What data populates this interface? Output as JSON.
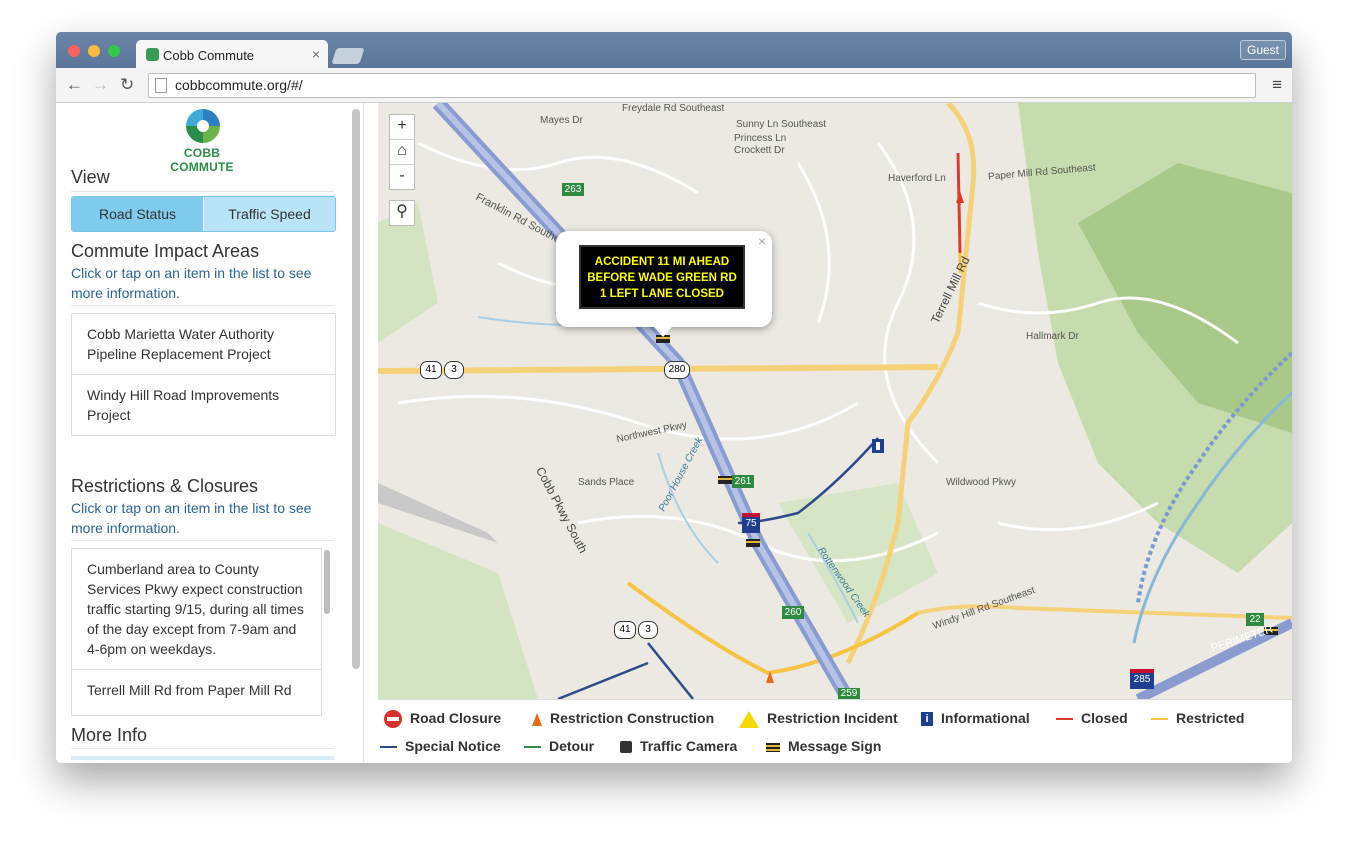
{
  "browser": {
    "tab_title": "Cobb Commute",
    "guest_label": "Guest",
    "url": "cobbcommute.org/#/"
  },
  "sidebar": {
    "logo_text": "COBB COMMUTE",
    "view_heading": "View",
    "view_buttons": [
      "Road Status",
      "Traffic Speed"
    ],
    "impact_heading": "Commute Impact Areas",
    "impact_hint": "Click or tap on an item in the list to see more information.",
    "impact_items": [
      "Cobb Marietta Water Authority Pipeline Replacement Project",
      "Windy Hill Road Improvements Project"
    ],
    "restrictions_heading": "Restrictions & Closures",
    "restrictions_hint": "Click or tap on an item in the list to see more information.",
    "restriction_items": [
      "Cumberland area to County Services Pkwy expect construction traffic starting 9/15, during all times of the day except from 7-9am and 4-6pm on weekdays.",
      "Terrell Mill Rd from Paper Mill Rd"
    ],
    "more_info_heading": "More Info"
  },
  "map": {
    "zoom_controls": [
      "+",
      "⌂",
      "-"
    ],
    "search_icon": "magnifier",
    "popup": {
      "sign_lines": [
        "ACCIDENT 11 MI AHEAD",
        "BEFORE WADE GREEN RD",
        "1 LEFT LANE CLOSED"
      ],
      "close_glyph": "×"
    },
    "labels": {
      "franklin": "Franklin Rd Southeast",
      "terrell": "Terrell Mill Rd",
      "cobb_pkwy": "Cobb Pkwy South",
      "sands": "Sands Place",
      "hallmark": "Hallmark Dr",
      "paper_mill": "Paper Mill Rd Southeast",
      "wildwood": "Wildwood Pkwy",
      "perimeter": "PERIMETER",
      "haverford": "Haverford Ln",
      "mayes": "Mayes Dr",
      "freydale": "Freydale Rd Southeast",
      "sunny": "Sunny Ln Southeast",
      "princess": "Princess Ln",
      "crockett": "Crockett Dr",
      "northwest": "Northwest Pkwy",
      "windy": "Windy Hill Rd Southeast",
      "rottenwood": "Rottenwood Creek",
      "poor_house": "Poor House Creek"
    },
    "shields": {
      "us41a": "41",
      "sr3a": "3",
      "i280": "280",
      "exit263": "263",
      "exit261": "261",
      "i75": "75",
      "exit260": "260",
      "us41b": "41",
      "sr3b": "3",
      "exit259": "259",
      "i285": "285",
      "exit22": "22"
    },
    "colors": {
      "closed": "#e03a2a",
      "restricted": "#f5c445",
      "special_notice": "#2d4a8a",
      "detour": "#2f8f3e",
      "interstate": "#8a9bd0"
    }
  },
  "legend": {
    "items": [
      {
        "label": "Road Closure",
        "icon": "road-closure-icon"
      },
      {
        "label": "Restriction Construction",
        "icon": "cone-icon"
      },
      {
        "label": "Restriction Incident",
        "icon": "warning-icon"
      },
      {
        "label": "Informational",
        "icon": "info-icon"
      },
      {
        "label": "Closed",
        "icon": "red-line-icon"
      },
      {
        "label": "Restricted",
        "icon": "yellow-line-icon"
      },
      {
        "label": "Special Notice",
        "icon": "blue-line-icon"
      },
      {
        "label": "Detour",
        "icon": "green-line-icon"
      },
      {
        "label": "Traffic Camera",
        "icon": "camera-icon"
      },
      {
        "label": "Message Sign",
        "icon": "message-sign-icon"
      }
    ]
  }
}
